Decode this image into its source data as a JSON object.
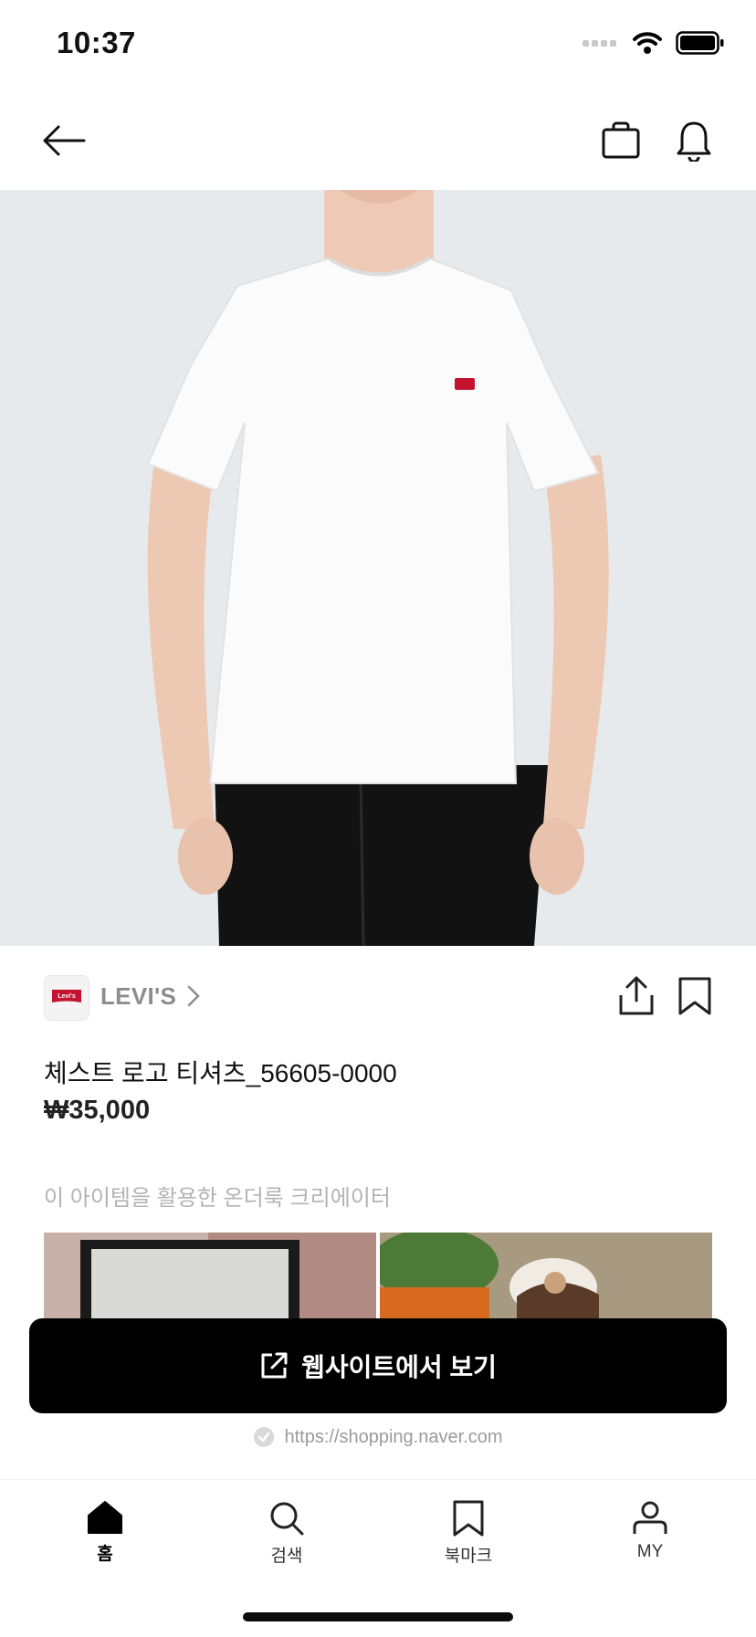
{
  "status_bar": {
    "time": "10:37"
  },
  "brand": {
    "name": "LEVI'S",
    "logo_text": "Levi's"
  },
  "product": {
    "title": "체스트 로고 티셔츠_56605-0000",
    "price": "₩35,000"
  },
  "creators": {
    "label": "이 아이템을 활용한 온더룩 크리에이터"
  },
  "cta": {
    "label": "웹사이트에서 보기",
    "url": "https://shopping.naver.com"
  },
  "tabbar": {
    "items": [
      {
        "label": "홈",
        "icon": "home-icon",
        "active": true
      },
      {
        "label": "검색",
        "icon": "search-icon",
        "active": false
      },
      {
        "label": "북마크",
        "icon": "bookmark-icon",
        "active": false
      },
      {
        "label": "MY",
        "icon": "user-icon",
        "active": false
      }
    ]
  },
  "colors": {
    "cta_bg": "#000000",
    "brand_red": "#c41230",
    "hero_bg": "#e7eaec"
  }
}
